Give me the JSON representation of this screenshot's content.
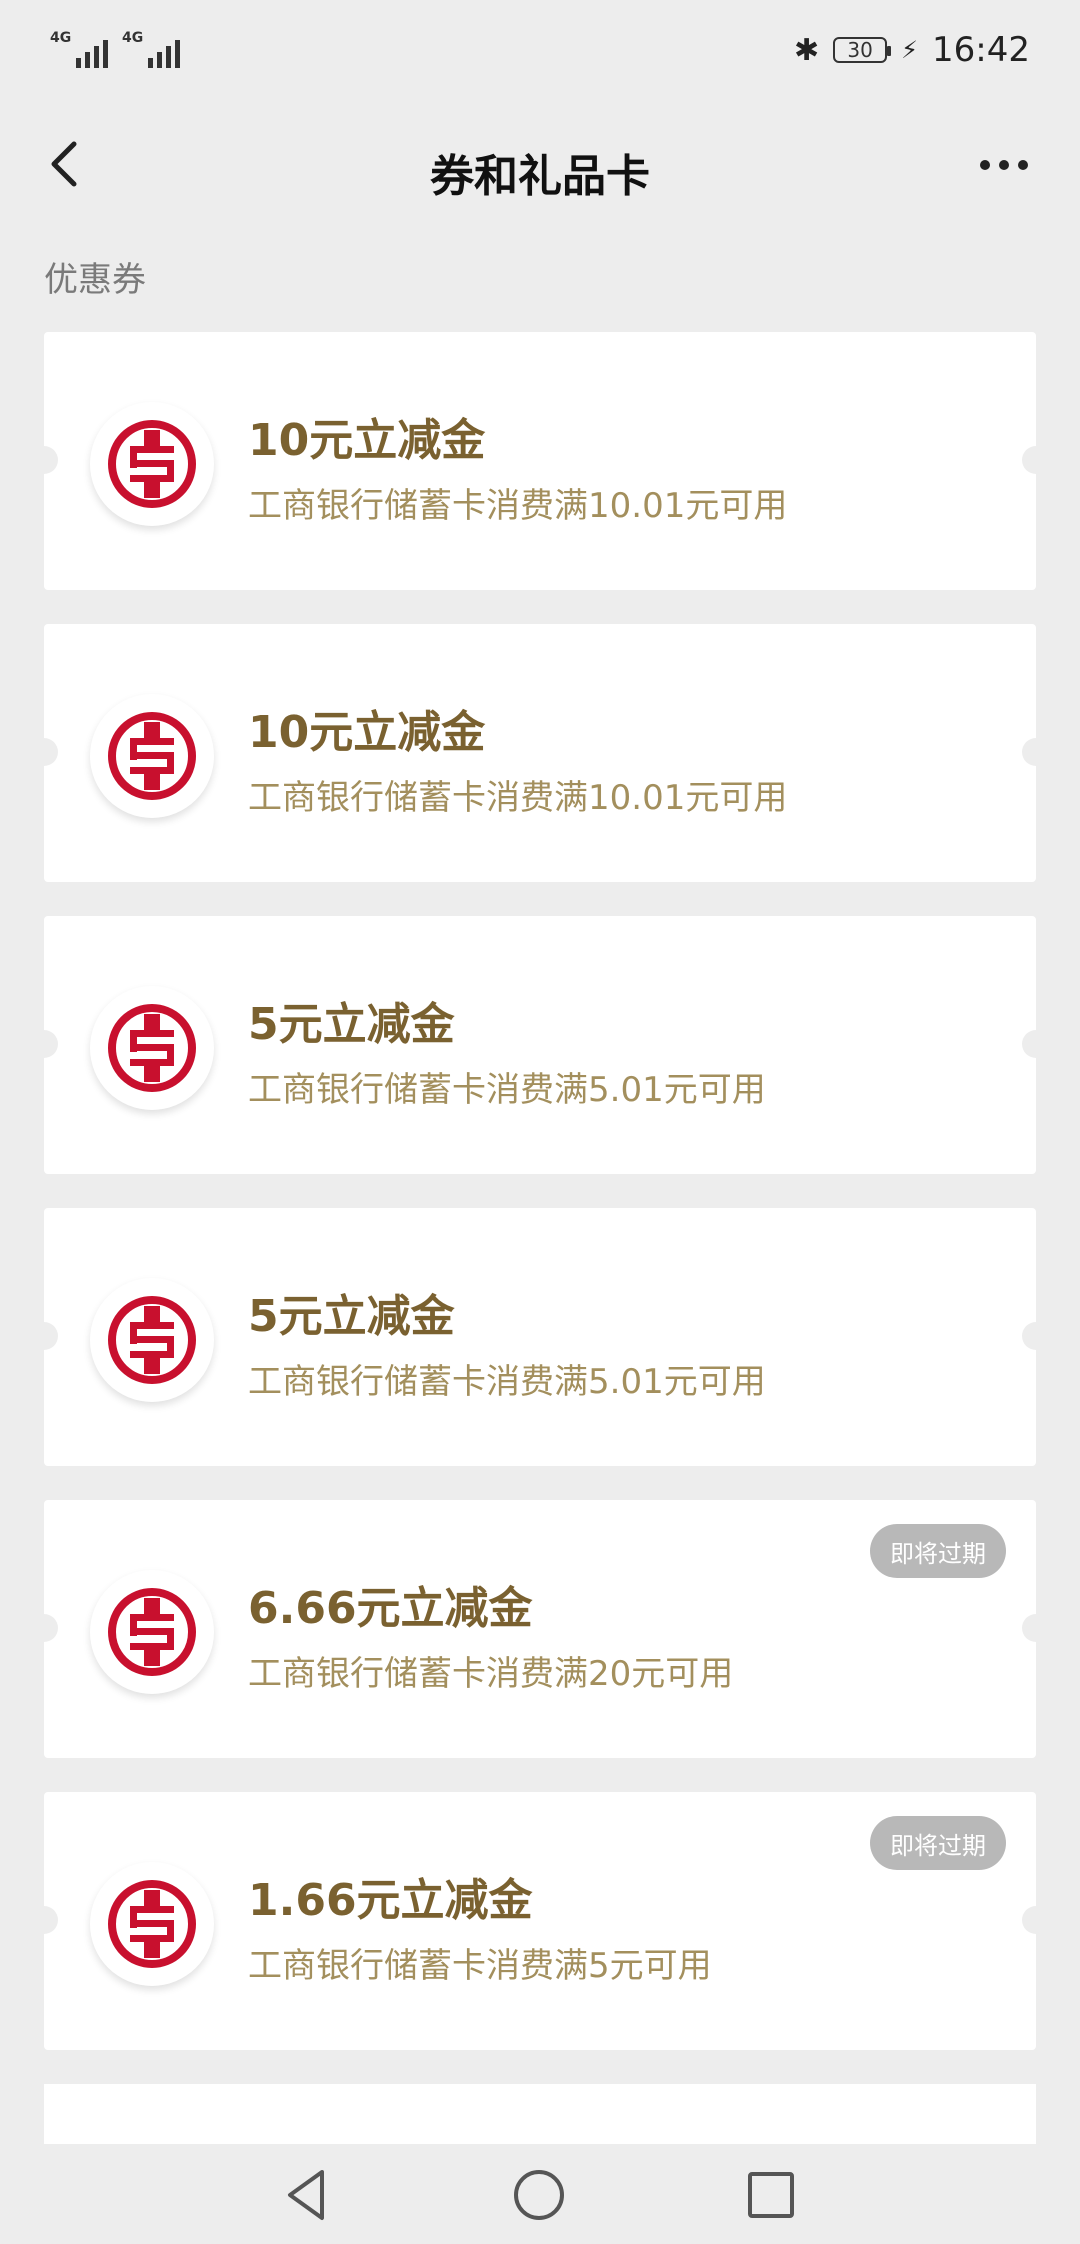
{
  "status": {
    "sig1": "4G",
    "sig2": "4G",
    "battery": "30",
    "time": "16:42"
  },
  "nav": {
    "title": "券和礼品卡"
  },
  "section": {
    "title": "优惠券"
  },
  "coupons": [
    {
      "title": "10元立减金",
      "desc": "工商银行储蓄卡消费满10.01元可用",
      "badge": ""
    },
    {
      "title": "10元立减金",
      "desc": "工商银行储蓄卡消费满10.01元可用",
      "badge": ""
    },
    {
      "title": "5元立减金",
      "desc": "工商银行储蓄卡消费满5.01元可用",
      "badge": ""
    },
    {
      "title": "5元立减金",
      "desc": "工商银行储蓄卡消费满5.01元可用",
      "badge": ""
    },
    {
      "title": "6.66元立减金",
      "desc": "工商银行储蓄卡消费满20元可用",
      "badge": "即将过期"
    },
    {
      "title": "1.66元立减金",
      "desc": "工商银行储蓄卡消费满5元可用",
      "badge": "即将过期"
    }
  ],
  "colors": {
    "brand_red": "#c8102e",
    "title_gold": "#7a6130",
    "desc_gold": "#a38f5d",
    "badge_gray": "#b8b8b8"
  }
}
